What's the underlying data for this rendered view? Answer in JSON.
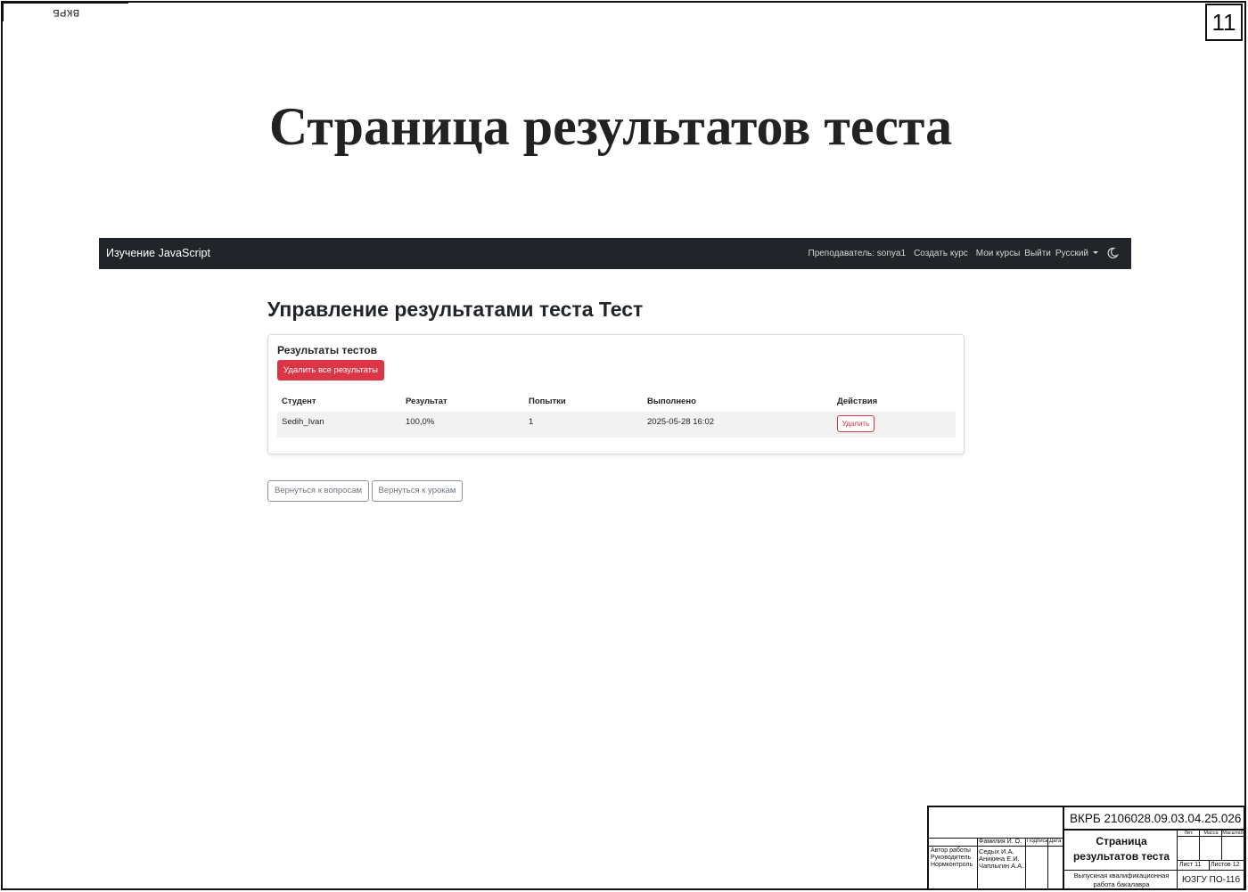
{
  "document": {
    "corner_code": "ВКРБ 2106028.09.03.04.25.026",
    "sheet_number": "11",
    "slide_title": "Страница результатов теста"
  },
  "app": {
    "brand": "Изучение JavaScript",
    "nav": {
      "teacher": "Преподаватель: sonya1",
      "create_course": "Создать курс",
      "my_courses": "Мои курсы",
      "logout": "Выйти",
      "language": "Русский",
      "theme_icon": "moon-icon"
    },
    "page_heading": "Управление результатами теста Тест",
    "card": {
      "title": "Результаты тестов",
      "delete_all_label": "Удалить все результаты"
    },
    "table": {
      "columns": [
        "Студент",
        "Результат",
        "Попытки",
        "Выполнено",
        "Действия"
      ],
      "rows": [
        {
          "student": "Sedih_Ivan",
          "result": "100,0%",
          "attempts": "1",
          "completed": "2025-05-28 16:02",
          "action_label": "Удалить"
        }
      ]
    },
    "back_to_questions": "Вернуться к вопросам",
    "back_to_lessons": "Вернуться к урокам",
    "colors": {
      "navbar": "#212529",
      "danger": "#dc3545",
      "secondary": "#6c757d"
    }
  },
  "stamp": {
    "code": "ВКРБ 2106028.09.03.04.25.026",
    "col_headers": [
      "Фамилия И. О.",
      "Подпись",
      "Дата"
    ],
    "roles": [
      "Автор работы",
      "Руководитель",
      "Нормконтроль"
    ],
    "names": [
      "Седых И.А.",
      "Аникина Е.И.",
      "Чаплыгин А.А."
    ],
    "title": "Страница результатов теста",
    "lit_headers": [
      "Лит.",
      "Масса",
      "Масштаб"
    ],
    "sheet": "Лист 11",
    "sheets": "Листов 12",
    "work_type": "Выпускная квалификационная работа бакалавра",
    "org": "ЮЗГУ ПО-11б"
  }
}
